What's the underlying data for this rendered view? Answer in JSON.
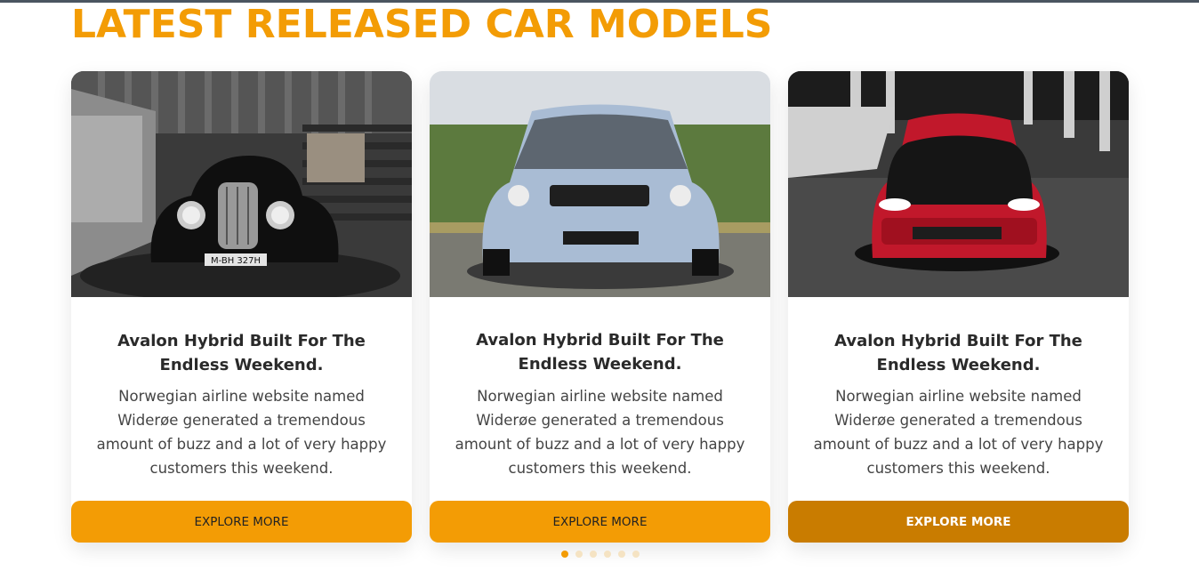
{
  "section": {
    "heading": "LATEST RELEASED CAR MODELS"
  },
  "cards": [
    {
      "image": "vintage-black-car-photo",
      "title": "Avalon Hybrid Built For The Endless Weekend.",
      "description": "Norwegian airline website named Widerøe generated a tremendous amount of buzz and a lot of very happy customers this weekend.",
      "plate": "M-BH 327H",
      "button_label": "EXPLORE MORE"
    },
    {
      "image": "silver-sedan-photo",
      "title": "Avalon Hybrid Built For The Endless Weekend.",
      "description": "Norwegian airline website named Widerøe generated a tremendous amount of buzz and a lot of very happy customers this weekend.",
      "button_label": "EXPLORE MORE"
    },
    {
      "image": "red-hatchback-photo",
      "title": "Avalon Hybrid Built For The Endless Weekend.",
      "description": "Norwegian airline website named Widerøe generated a tremendous amount of buzz and a lot of very happy customers this weekend.",
      "button_label": "EXPLORE MORE"
    }
  ],
  "carousel": {
    "pages": 6,
    "active_page": 1
  },
  "colors": {
    "accent": "#f39c05",
    "accent_dark": "#c97c00",
    "heading": "#f39c05"
  }
}
